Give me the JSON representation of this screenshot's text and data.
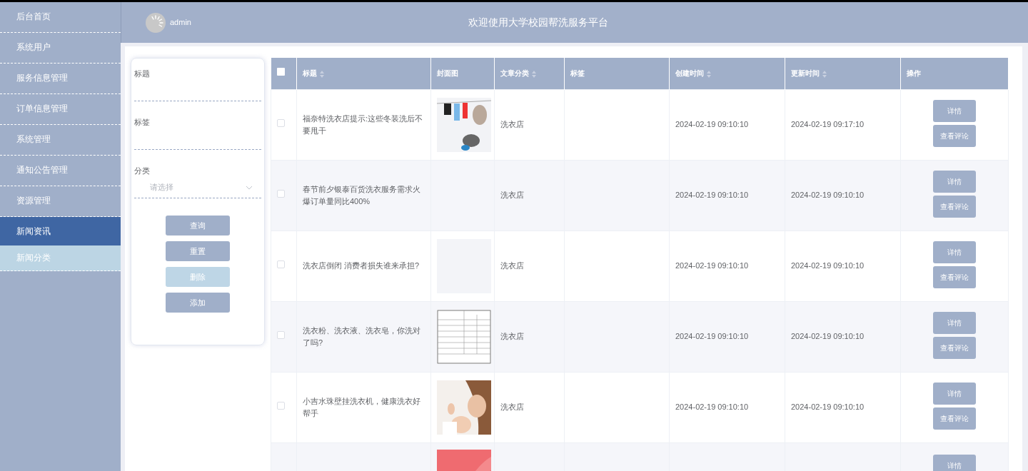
{
  "sidebar": {
    "items": [
      {
        "label": "后台首页",
        "selected": false
      },
      {
        "label": "系统用户",
        "selected": false
      },
      {
        "label": "服务信息管理",
        "selected": false
      },
      {
        "label": "订单信息管理",
        "selected": false
      },
      {
        "label": "系统管理",
        "selected": false
      },
      {
        "label": "通知公告管理",
        "selected": false
      },
      {
        "label": "资源管理",
        "selected": false
      },
      {
        "label": "新闻资讯",
        "selected": true,
        "children": [
          {
            "label": "新闻分类",
            "hovered": true
          }
        ]
      }
    ]
  },
  "header": {
    "user": "admin",
    "title": "欢迎使用大学校园帮洗服务平台"
  },
  "filter": {
    "fields": [
      {
        "kind": "text",
        "label": "标题"
      },
      {
        "kind": "text",
        "label": "标签"
      },
      {
        "kind": "select",
        "label": "分类",
        "placeholder": "请选择"
      }
    ],
    "buttons": [
      {
        "label": "查询",
        "disabled": false
      },
      {
        "label": "重置",
        "disabled": false
      },
      {
        "label": "删除",
        "disabled": true
      },
      {
        "label": "添加",
        "disabled": false
      }
    ]
  },
  "table": {
    "columns": [
      {
        "kind": "checkbox",
        "checked": false
      },
      {
        "label": "标题",
        "sortable": true
      },
      {
        "label": "封面图",
        "sortable": false
      },
      {
        "label": "文章分类",
        "sortable": true
      },
      {
        "label": "标签",
        "sortable": false
      },
      {
        "label": "创建时间",
        "sortable": true
      },
      {
        "label": "更新时间",
        "sortable": true
      },
      {
        "label": "操作",
        "sortable": false
      }
    ],
    "rows": [
      {
        "checked": false,
        "title": "福奈特洗衣店提示:这些冬装洗后不要甩干",
        "cover": {
          "kind": "picture"
        },
        "category": "洗衣店",
        "created": "2024-02-19 09:10:10",
        "updated": "2024-02-19 09:17:10",
        "actions": [
          "详情",
          "查看评论"
        ]
      },
      {
        "checked": false,
        "title": "春节前夕银泰百货洗衣服务需求火爆订单量同比400%",
        "category": "洗衣店",
        "created": "2024-02-19 09:10:10",
        "updated": "2024-02-19 09:10:10",
        "actions": [
          "详情",
          "查看评论"
        ]
      },
      {
        "checked": false,
        "title": "洗衣店倒闭 消费者损失谁来承担?",
        "cover": {
          "kind": "blank"
        },
        "category": "洗衣店",
        "created": "2024-02-19 09:10:10",
        "updated": "2024-02-19 09:10:10",
        "actions": [
          "详情",
          "查看评论"
        ]
      },
      {
        "checked": false,
        "title": "洗衣粉、洗衣液、洗衣皂，你洗对了吗?",
        "cover": {
          "kind": "picture"
        },
        "category": "洗衣店",
        "created": "2024-02-19 09:10:10",
        "updated": "2024-02-19 09:10:10",
        "actions": [
          "详情",
          "查看评论"
        ]
      },
      {
        "checked": false,
        "title": "小吉水珠壁挂洗衣机，健康洗衣好帮手",
        "cover": {
          "kind": "picture"
        },
        "category": "洗衣店",
        "created": "2024-02-19 09:10:10",
        "updated": "2024-02-19 09:10:10",
        "actions": [
          "详情",
          "查看评论"
        ]
      },
      {
        "cover": {
          "kind": "picture"
        },
        "actions": [
          "详情"
        ]
      }
    ]
  }
}
